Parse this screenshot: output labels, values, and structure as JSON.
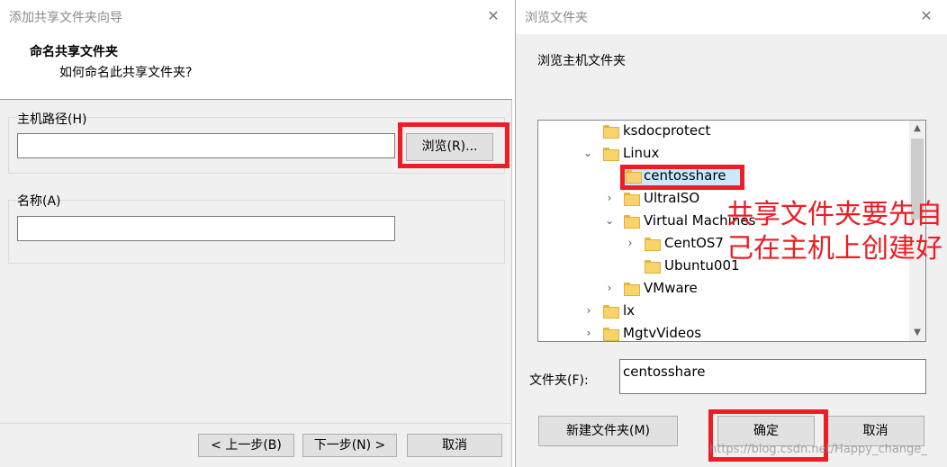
{
  "wizard": {
    "title": "添加共享文件夹向导",
    "heading": "命名共享文件夹",
    "subheading": "如何命名此共享文件夹?",
    "host_path_label": "主机路径(H)",
    "host_path_value": "",
    "browse_button": "浏览(R)...",
    "name_label": "名称(A)",
    "name_value": "",
    "back_button": "< 上一步(B)",
    "next_button": "下一步(N) >",
    "cancel_button": "取消",
    "close_glyph": "✕"
  },
  "browse_dialog": {
    "title": "浏览文件夹",
    "prompt": "浏览主机文件夹",
    "tree_items": [
      {
        "label": "ksdocprotect",
        "expander": ""
      },
      {
        "label": "Linux",
        "expander": "⌄"
      },
      {
        "label": "centosshare",
        "expander": ""
      },
      {
        "label": "UltraISO",
        "expander": "›"
      },
      {
        "label": "Virtual Machines",
        "expander": "⌄"
      },
      {
        "label": "CentOS7",
        "expander": "›"
      },
      {
        "label": "Ubuntu001",
        "expander": ""
      },
      {
        "label": "VMware",
        "expander": "›"
      },
      {
        "label": "lx",
        "expander": "›"
      },
      {
        "label": "MgtvVideos",
        "expander": "›"
      }
    ],
    "folder_label": "文件夹(F):",
    "folder_value": "centosshare",
    "new_folder_button": "新建文件夹(M)",
    "ok_button": "确定",
    "cancel_button": "取消",
    "close_glyph": "✕",
    "scroll_up_glyph": "▲",
    "scroll_down_glyph": "▼"
  },
  "annotation": {
    "line1": "共享文件夹要先自",
    "line2": "己在主机上创建好"
  },
  "watermark": "https://blog.csdn.net/Happy_change_",
  "colors": {
    "highlight_red": "#ee1c24",
    "selection_blue": "#cce8ff",
    "folder_yellow": "#f8d26a"
  }
}
